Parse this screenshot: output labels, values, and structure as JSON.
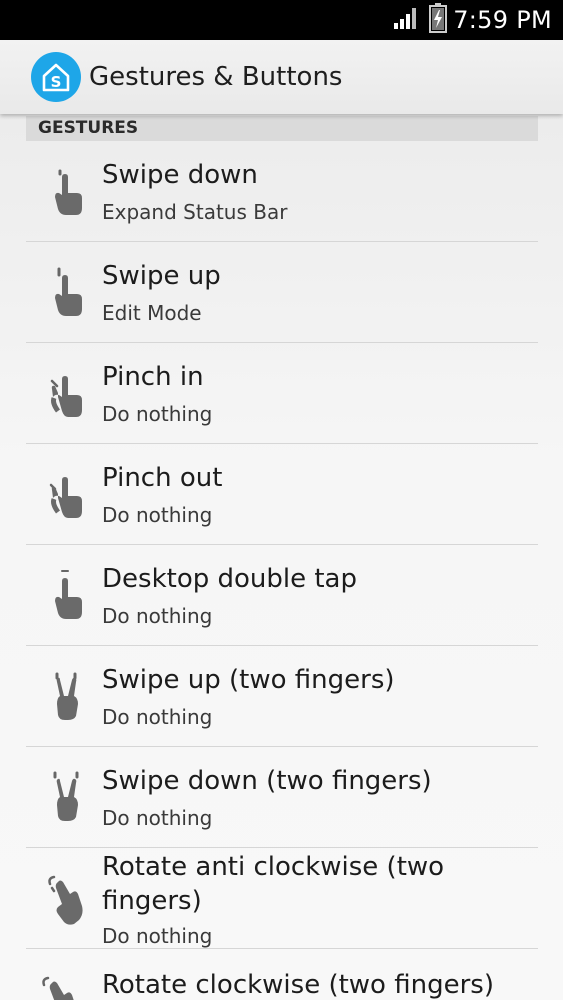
{
  "status_bar": {
    "time": "7:59 PM",
    "icons": [
      "signal-icon",
      "battery-charging-icon"
    ]
  },
  "app_bar": {
    "title": "Gestures & Buttons",
    "icon": "launcher-s-icon",
    "accent_color": "#1ea6e8"
  },
  "section": {
    "header": "GESTURES"
  },
  "gestures": [
    {
      "title": "Swipe down",
      "subtitle": "Expand Status Bar",
      "icon": "swipe-down-gesture-icon"
    },
    {
      "title": "Swipe up",
      "subtitle": "Edit Mode",
      "icon": "swipe-up-gesture-icon"
    },
    {
      "title": "Pinch in",
      "subtitle": "Do nothing",
      "icon": "pinch-in-gesture-icon"
    },
    {
      "title": "Pinch out",
      "subtitle": "Do nothing",
      "icon": "pinch-out-gesture-icon"
    },
    {
      "title": "Desktop double tap",
      "subtitle": "Do nothing",
      "icon": "double-tap-gesture-icon"
    },
    {
      "title": "Swipe up (two fingers)",
      "subtitle": "Do nothing",
      "icon": "two-finger-swipe-up-gesture-icon"
    },
    {
      "title": "Swipe down (two fingers)",
      "subtitle": "Do nothing",
      "icon": "two-finger-swipe-down-gesture-icon"
    },
    {
      "title": "Rotate anti clockwise (two fingers)",
      "subtitle": "Do nothing",
      "icon": "rotate-anticlockwise-gesture-icon"
    },
    {
      "title": "Rotate clockwise (two fingers)",
      "subtitle": "",
      "icon": "rotate-clockwise-gesture-icon"
    }
  ]
}
